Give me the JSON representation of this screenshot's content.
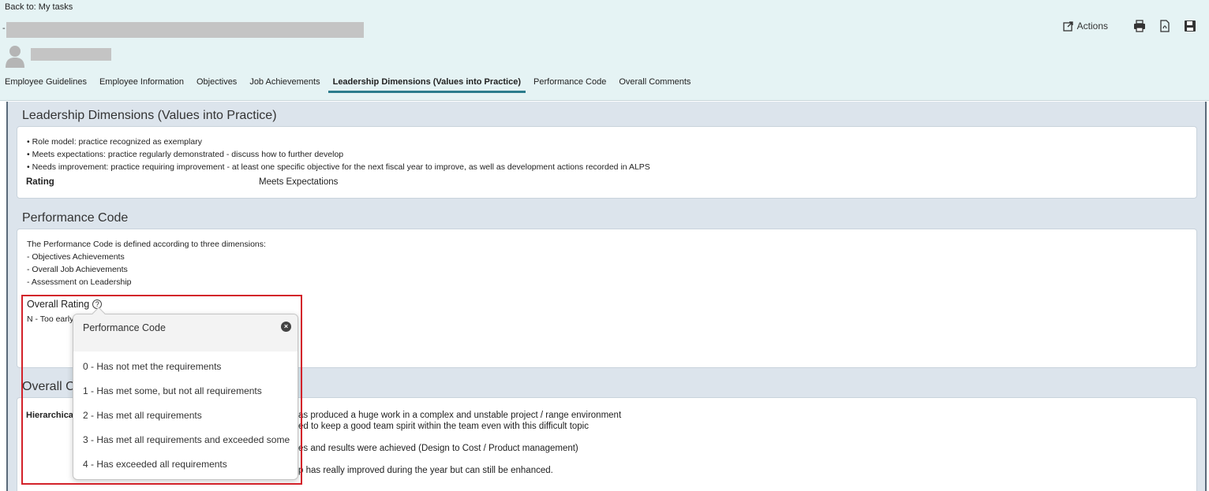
{
  "header": {
    "back_link": "Back to: My tasks",
    "actions_label": "Actions"
  },
  "tabs": [
    {
      "label": "Employee Guidelines"
    },
    {
      "label": "Employee Information"
    },
    {
      "label": "Objectives"
    },
    {
      "label": "Job Achievements"
    },
    {
      "label": "Leadership Dimensions (Values into Practice)",
      "active": true
    },
    {
      "label": "Performance Code"
    },
    {
      "label": "Overall Comments"
    }
  ],
  "leadership": {
    "title": "Leadership Dimensions (Values into Practice)",
    "bullets": [
      "• Role model: practice recognized as exemplary",
      "• Meets expectations: practice regularly demonstrated - discuss how to further develop",
      "• Needs improvement: practice requiring improvement - at least one specific objective for the next fiscal year to improve, as well as development actions recorded in ALPS"
    ],
    "rating_label": "Rating",
    "rating_value": "Meets Expectations"
  },
  "performance": {
    "title": "Performance Code",
    "lines": [
      "The Performance Code is defined according to three dimensions:",
      "- Objectives Achievements",
      "- Overall Job Achievements",
      "- Assessment on Leadership"
    ],
    "overall_rating_label": "Overall Rating",
    "overall_rating_value": "N - Too early"
  },
  "overall": {
    "title_visible": "Overall C",
    "hier_label": "Hierarchica",
    "comment_lines": [
      "as produced a huge work in a complex and unstable project / range environment",
      "ed to keep a good team spirit within the team even with this difficult topic",
      "",
      "es and results were achieved (Design to Cost / Product management)",
      "",
      "p has really improved during the year but can still be enhanced."
    ]
  },
  "popover": {
    "title": "Performance Code",
    "items": [
      "0 - Has not met the requirements",
      "1 - Has met some, but not all requirements",
      "2 - Has met all requirements",
      "3 - Has met all requirements and exceeded some",
      "4 - Has exceeded all requirements"
    ]
  },
  "colors": {
    "header_bg": "#e5f3f4",
    "content_bg": "#dce4ec",
    "tab_active_underline": "#2b7c8c",
    "highlight_frame": "#d3222a"
  }
}
